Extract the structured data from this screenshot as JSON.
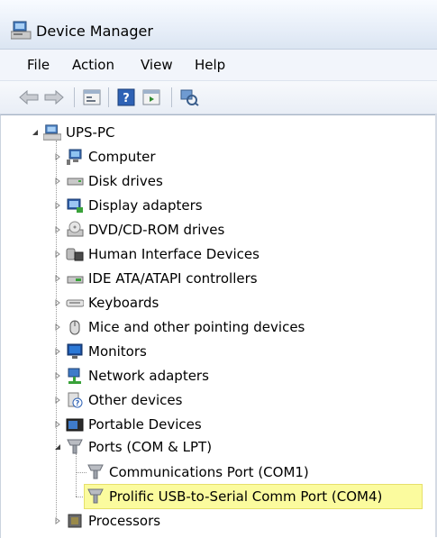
{
  "window": {
    "title": "Device Manager"
  },
  "menu": [
    "File",
    "Action",
    "View",
    "Help"
  ],
  "toolbar": [
    {
      "name": "back-icon"
    },
    {
      "name": "forward-icon"
    },
    {
      "name": "properties-icon"
    },
    {
      "name": "help-icon"
    },
    {
      "name": "update-driver-icon"
    },
    {
      "name": "scan-hardware-icon"
    }
  ],
  "tree": {
    "root": "UPS-PC",
    "items": [
      {
        "label": "Computer",
        "icon": "computer-icon"
      },
      {
        "label": "Disk drives",
        "icon": "disk-drive-icon"
      },
      {
        "label": "Display adapters",
        "icon": "display-adapter-icon"
      },
      {
        "label": "DVD/CD-ROM drives",
        "icon": "dvd-icon"
      },
      {
        "label": "Human Interface Devices",
        "icon": "hid-icon"
      },
      {
        "label": "IDE ATA/ATAPI controllers",
        "icon": "ide-controller-icon"
      },
      {
        "label": "Keyboards",
        "icon": "keyboard-icon"
      },
      {
        "label": "Mice and other pointing devices",
        "icon": "mouse-icon"
      },
      {
        "label": "Monitors",
        "icon": "monitor-icon"
      },
      {
        "label": "Network adapters",
        "icon": "network-adapter-icon"
      },
      {
        "label": "Other devices",
        "icon": "unknown-device-icon"
      },
      {
        "label": "Portable Devices",
        "icon": "portable-device-icon"
      },
      {
        "label": "Ports (COM & LPT)",
        "icon": "port-icon"
      },
      {
        "label": "Processors",
        "icon": "processor-icon"
      }
    ],
    "ports_children": [
      {
        "label": "Communications Port (COM1)",
        "icon": "port-icon"
      },
      {
        "label": "Prolific USB-to-Serial Comm Port (COM4)",
        "icon": "port-icon"
      }
    ]
  },
  "colors": {
    "selection": "#fbfb9e"
  }
}
